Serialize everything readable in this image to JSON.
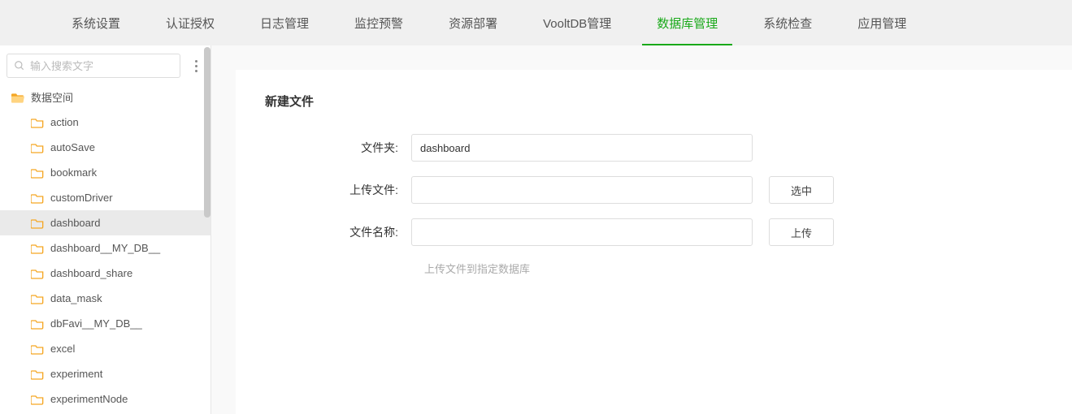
{
  "nav": {
    "items": [
      {
        "label": "系统设置"
      },
      {
        "label": "认证授权"
      },
      {
        "label": "日志管理"
      },
      {
        "label": "监控预警"
      },
      {
        "label": "资源部署"
      },
      {
        "label": "VooltDB管理"
      },
      {
        "label": "数据库管理",
        "active": true
      },
      {
        "label": "系统检查"
      },
      {
        "label": "应用管理"
      }
    ]
  },
  "sidebar": {
    "search_placeholder": "输入搜索文字",
    "root": {
      "label": "数据空间"
    },
    "items": [
      {
        "label": "action"
      },
      {
        "label": "autoSave"
      },
      {
        "label": "bookmark"
      },
      {
        "label": "customDriver"
      },
      {
        "label": "dashboard",
        "selected": true
      },
      {
        "label": "dashboard__MY_DB__"
      },
      {
        "label": "dashboard_share"
      },
      {
        "label": "data_mask"
      },
      {
        "label": "dbFavi__MY_DB__"
      },
      {
        "label": "excel"
      },
      {
        "label": "experiment"
      },
      {
        "label": "experimentNode"
      }
    ]
  },
  "main": {
    "panel_title": "新建文件",
    "folder_label": "文件夹:",
    "folder_value": "dashboard",
    "upload_label": "上传文件:",
    "select_button": "选中",
    "filename_label": "文件名称:",
    "upload_button": "上传",
    "hint": "上传文件到指定数据库"
  }
}
